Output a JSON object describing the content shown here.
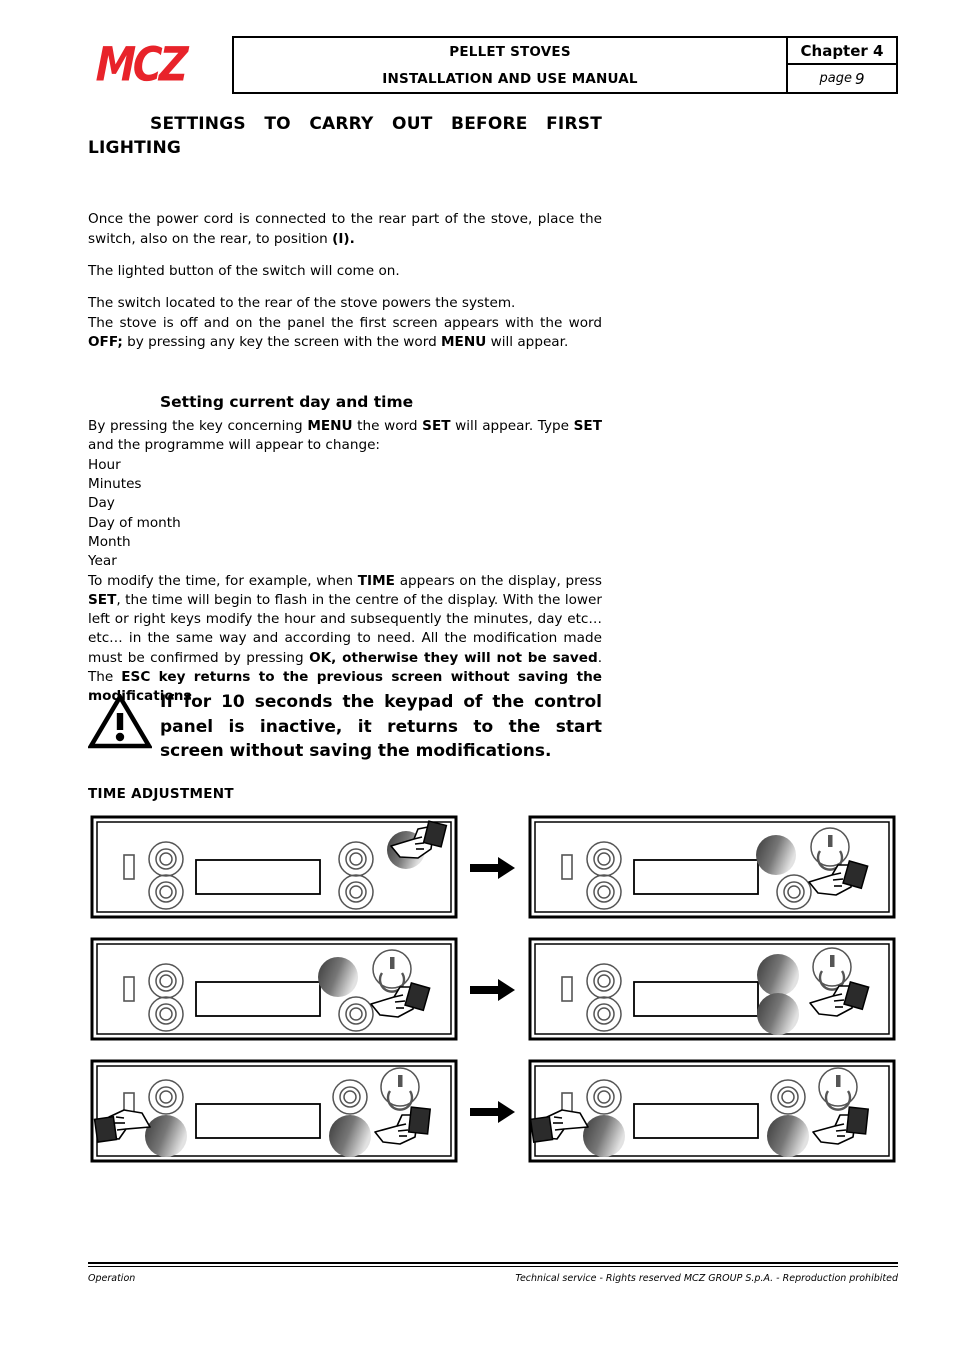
{
  "header": {
    "logo": "MCZ",
    "title_line_1": "PELLET STOVES",
    "title_line_2": "INSTALLATION AND USE MANUAL",
    "chapter": "Chapter 4",
    "page_label": "page",
    "page_number": "9",
    "brand_color": "#e8232a"
  },
  "section": {
    "title": "SETTINGS TO CARRY OUT BEFORE FIRST LIGHTING",
    "paragraph_1_a": "Once the power cord is connected to the rear part of the stove, place the switch, also on the rear, to position ",
    "paragraph_1_b": "(I).",
    "paragraph_2": "The lighted button of the switch will come on.",
    "paragraph_3": "The switch located to the rear of the stove powers the system.",
    "paragraph_4_a": "The stove is off and on the panel the first screen appears with the word ",
    "paragraph_4_b": "OFF;",
    "paragraph_4_c": " by pressing any key the screen with the word ",
    "paragraph_4_d": "MENU",
    "paragraph_4_e": " will appear."
  },
  "subsection": {
    "title": "Setting current day and time",
    "intro_a": "By pressing the key concerning ",
    "intro_b": "MENU",
    "intro_c": " the word ",
    "intro_d": "SET",
    "intro_e": " will appear. Type ",
    "intro_f": "SET",
    "intro_g": " and the programme will appear to change:",
    "items": [
      "Hour",
      "Minutes",
      "Day",
      "Day of month",
      "Month",
      "Year"
    ],
    "detail_a": "To modify the time, for example, when ",
    "detail_b": "TIME",
    "detail_c": " appears on the display, press ",
    "detail_d": "SET",
    "detail_e": ", the time will begin to flash in the centre of the display. With the lower left or right keys modify the hour and subsequently the minutes, day etc… etc… in the same way and according to need. All the modification made must be confirmed by pressing ",
    "detail_f": "OK, otherwise they will not be saved",
    "detail_g": ". The ",
    "detail_h": "ESC key returns to the previous screen without saving the modifications",
    "detail_i": "."
  },
  "warning": {
    "icon": "warning-triangle-icon",
    "text": "If for 10 seconds the keypad of the control panel is inactive, it returns to the start screen without saving the modifications."
  },
  "figure": {
    "label": "TIME ADJUSTMENT",
    "arrow_icon": "arrow-right-icon",
    "steps": [
      {
        "id": "step-1",
        "power_icon_visible": false,
        "top_right_knob_dark": true,
        "bottom_right_knob_dark": false,
        "hand_right_position": "top",
        "hand_left_visible": false
      },
      {
        "id": "step-2",
        "power_icon_visible": true,
        "top_right_knob_dark": true,
        "bottom_right_knob_dark": false,
        "hand_right_position": "bottom",
        "hand_left_visible": false
      },
      {
        "id": "step-3",
        "power_icon_visible": true,
        "top_right_knob_dark": true,
        "bottom_right_knob_dark": false,
        "hand_right_position": "bottom",
        "hand_left_visible": false
      },
      {
        "id": "step-4",
        "power_icon_visible": true,
        "top_right_knob_dark": true,
        "bottom_right_knob_dark": true,
        "hand_right_position": "bottom",
        "hand_left_visible": false
      },
      {
        "id": "step-5",
        "power_icon_visible": true,
        "top_right_knob_dark": false,
        "bottom_right_knob_dark": true,
        "hand_right_position": "bottom",
        "hand_left_visible": true
      },
      {
        "id": "step-6",
        "power_icon_visible": true,
        "top_right_knob_dark": false,
        "bottom_right_knob_dark": true,
        "hand_right_position": "bottom",
        "hand_left_visible": true
      }
    ]
  },
  "footer": {
    "left": "Operation",
    "right": "Technical service - Rights reserved MCZ GROUP S.p.A. - Reproduction prohibited"
  }
}
